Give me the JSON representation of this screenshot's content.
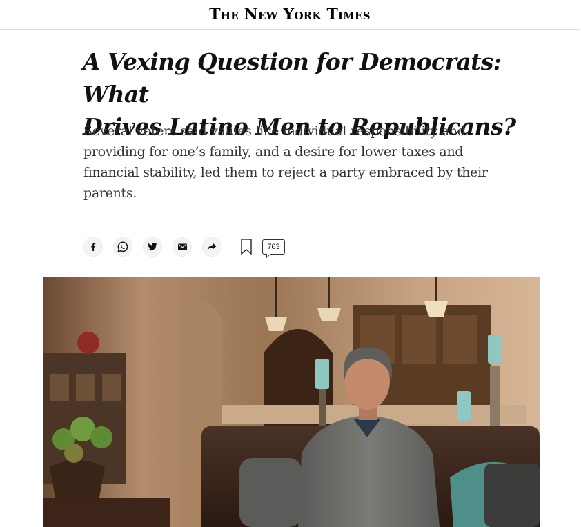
{
  "masthead": {
    "logo_text": "The New York Times"
  },
  "article": {
    "headline_line1": "A Vexing Question for Democrats: What",
    "headline_line2": "Drives Latino Men to Republicans?",
    "summary": "Several voters said values like individual responsibility and providing for one’s family, and a desire for lower taxes and financial stability, led them to reject a party embraced by their parents."
  },
  "share_tools": {
    "buttons": [
      {
        "icon": "facebook-icon"
      },
      {
        "icon": "whatsapp-icon"
      },
      {
        "icon": "twitter-icon"
      },
      {
        "icon": "email-icon"
      },
      {
        "icon": "share-arrow-icon"
      }
    ],
    "bookmark_icon": "bookmark-icon",
    "comment_count": "763"
  },
  "photo": {
    "description_icon": "lead-photo"
  },
  "colors": {
    "text": "#121212",
    "summary_text": "#363636",
    "rule": "#dfdfdf",
    "share_bg": "#f4f4f4"
  }
}
